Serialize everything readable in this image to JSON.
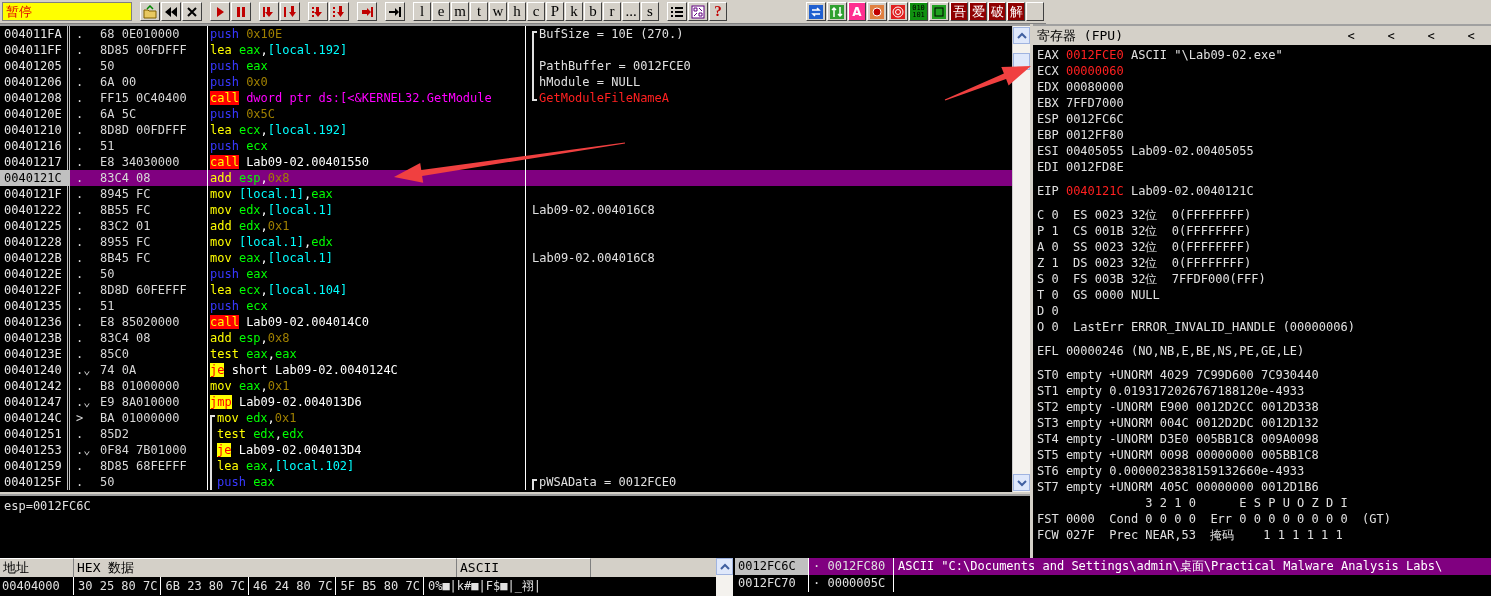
{
  "toolbar": {
    "status": "暂停",
    "letter_buttons": [
      "l",
      "e",
      "m",
      "t",
      "w",
      "h",
      "c",
      "P",
      "k",
      "b",
      "r",
      "...",
      "s"
    ],
    "help_button": "?",
    "right_buttons": [
      {
        "text": "A",
        "kind": "letter"
      },
      {
        "text": "010 101",
        "kind": "binary"
      },
      {
        "text": "吾",
        "kind": "glyph"
      },
      {
        "text": "爱",
        "kind": "glyph"
      },
      {
        "text": "破",
        "kind": "glyph"
      },
      {
        "text": "解",
        "kind": "glyph"
      }
    ]
  },
  "disassembly": {
    "rows": [
      {
        "address": "004011FA",
        "marker": ".",
        "hex": "68 0E010000",
        "code": [
          {
            "text": "push ",
            "kind": "push"
          },
          {
            "text": "0x10E",
            "kind": "imm"
          }
        ],
        "comment": {
          "text": "BufSize = 10E (270.)",
          "kind": "plain"
        },
        "comment_bracket": {
          "kind": "start"
        },
        "selected": false
      },
      {
        "address": "004011FF",
        "marker": ".",
        "hex": "8D85 00FDFFF",
        "code": [
          {
            "text": "lea ",
            "kind": "op"
          },
          {
            "text": "eax",
            "kind": "reg"
          },
          {
            "text": ",",
            "kind": "punct"
          },
          {
            "text": "[local.192]",
            "kind": "mem"
          }
        ],
        "comment_bracket": {
          "kind": "mid"
        },
        "selected": false
      },
      {
        "address": "00401205",
        "marker": ".",
        "hex": "50",
        "code": [
          {
            "text": "push ",
            "kind": "push"
          },
          {
            "text": "eax",
            "kind": "reg"
          }
        ],
        "comment": {
          "text": "PathBuffer = 0012FCE0",
          "kind": "plain"
        },
        "comment_bracket": {
          "kind": "mid"
        },
        "selected": false
      },
      {
        "address": "00401206",
        "marker": ".",
        "hex": "6A 00",
        "code": [
          {
            "text": "push ",
            "kind": "push"
          },
          {
            "text": "0x0",
            "kind": "imm"
          }
        ],
        "comment": {
          "text": "hModule = NULL",
          "kind": "plain"
        },
        "comment_bracket": {
          "kind": "mid"
        },
        "selected": false
      },
      {
        "address": "00401208",
        "marker": ".",
        "hex": "FF15 0C40400",
        "code": [
          {
            "text": "call",
            "kind": "call"
          },
          {
            "text": " dword ptr ds:[<&KERNEL32.GetModule",
            "kind": "api"
          }
        ],
        "comment": {
          "text": "GetModuleFileNameA",
          "kind": "api"
        },
        "comment_bracket": {
          "kind": "end"
        },
        "selected": false
      },
      {
        "address": "0040120E",
        "marker": ".",
        "hex": "6A 5C",
        "code": [
          {
            "text": "push ",
            "kind": "push"
          },
          {
            "text": "0x5C",
            "kind": "imm"
          }
        ],
        "selected": false
      },
      {
        "address": "00401210",
        "marker": ".",
        "hex": "8D8D 00FDFFF",
        "code": [
          {
            "text": "lea ",
            "kind": "op"
          },
          {
            "text": "ecx",
            "kind": "reg"
          },
          {
            "text": ",",
            "kind": "punct"
          },
          {
            "text": "[local.192]",
            "kind": "mem"
          }
        ],
        "selected": false
      },
      {
        "address": "00401216",
        "marker": ".",
        "hex": "51",
        "code": [
          {
            "text": "push ",
            "kind": "push"
          },
          {
            "text": "ecx",
            "kind": "reg"
          }
        ],
        "selected": false
      },
      {
        "address": "00401217",
        "marker": ".",
        "hex": "E8 34030000",
        "code": [
          {
            "text": "call",
            "kind": "call"
          },
          {
            "text": " Lab09-02.00401550",
            "kind": "label"
          }
        ],
        "selected": false
      },
      {
        "address": "0040121C",
        "marker": ".",
        "hex": "83C4 08",
        "code": [
          {
            "text": "add ",
            "kind": "op"
          },
          {
            "text": "esp",
            "kind": "reg"
          },
          {
            "text": ",",
            "kind": "punct"
          },
          {
            "text": "0x8",
            "kind": "imm"
          }
        ],
        "selected": true
      },
      {
        "address": "0040121F",
        "marker": ".",
        "hex": "8945 FC",
        "code": [
          {
            "text": "mov ",
            "kind": "op"
          },
          {
            "text": "[local.1]",
            "kind": "mem"
          },
          {
            "text": ",",
            "kind": "punct"
          },
          {
            "text": "eax",
            "kind": "reg"
          }
        ],
        "selected": false
      },
      {
        "address": "00401222",
        "marker": ".",
        "hex": "8B55 FC",
        "code": [
          {
            "text": "mov ",
            "kind": "op"
          },
          {
            "text": "edx",
            "kind": "reg"
          },
          {
            "text": ",",
            "kind": "punct"
          },
          {
            "text": "[local.1]",
            "kind": "mem"
          }
        ],
        "comment": {
          "text": "Lab09-02.004016C8",
          "kind": "plain"
        },
        "selected": false
      },
      {
        "address": "00401225",
        "marker": ".",
        "hex": "83C2 01",
        "code": [
          {
            "text": "add ",
            "kind": "op"
          },
          {
            "text": "edx",
            "kind": "reg"
          },
          {
            "text": ",",
            "kind": "punct"
          },
          {
            "text": "0x1",
            "kind": "imm"
          }
        ],
        "selected": false
      },
      {
        "address": "00401228",
        "marker": ".",
        "hex": "8955 FC",
        "code": [
          {
            "text": "mov ",
            "kind": "op"
          },
          {
            "text": "[local.1]",
            "kind": "mem"
          },
          {
            "text": ",",
            "kind": "punct"
          },
          {
            "text": "edx",
            "kind": "reg"
          }
        ],
        "selected": false
      },
      {
        "address": "0040122B",
        "marker": ".",
        "hex": "8B45 FC",
        "code": [
          {
            "text": "mov ",
            "kind": "op"
          },
          {
            "text": "eax",
            "kind": "reg"
          },
          {
            "text": ",",
            "kind": "punct"
          },
          {
            "text": "[local.1]",
            "kind": "mem"
          }
        ],
        "comment": {
          "text": "Lab09-02.004016C8",
          "kind": "plain"
        },
        "selected": false
      },
      {
        "address": "0040122E",
        "marker": ".",
        "hex": "50",
        "code": [
          {
            "text": "push ",
            "kind": "push"
          },
          {
            "text": "eax",
            "kind": "reg"
          }
        ],
        "selected": false
      },
      {
        "address": "0040122F",
        "marker": ".",
        "hex": "8D8D 60FEFFF",
        "code": [
          {
            "text": "lea ",
            "kind": "op"
          },
          {
            "text": "ecx",
            "kind": "reg"
          },
          {
            "text": ",",
            "kind": "punct"
          },
          {
            "text": "[local.104]",
            "kind": "mem"
          }
        ],
        "selected": false
      },
      {
        "address": "00401235",
        "marker": ".",
        "hex": "51",
        "code": [
          {
            "text": "push ",
            "kind": "push"
          },
          {
            "text": "ecx",
            "kind": "reg"
          }
        ],
        "selected": false
      },
      {
        "address": "00401236",
        "marker": ".",
        "hex": "E8 85020000",
        "code": [
          {
            "text": "call",
            "kind": "call"
          },
          {
            "text": " Lab09-02.004014C0",
            "kind": "label"
          }
        ],
        "selected": false
      },
      {
        "address": "0040123B",
        "marker": ".",
        "hex": "83C4 08",
        "code": [
          {
            "text": "add ",
            "kind": "op"
          },
          {
            "text": "esp",
            "kind": "reg"
          },
          {
            "text": ",",
            "kind": "punct"
          },
          {
            "text": "0x8",
            "kind": "imm"
          }
        ],
        "selected": false
      },
      {
        "address": "0040123E",
        "marker": ".",
        "hex": "85C0",
        "code": [
          {
            "text": "test ",
            "kind": "op"
          },
          {
            "text": "eax",
            "kind": "reg"
          },
          {
            "text": ",",
            "kind": "punct"
          },
          {
            "text": "eax",
            "kind": "reg"
          }
        ],
        "selected": false
      },
      {
        "address": "00401240",
        "marker": ".⌄",
        "hex": "74 0A",
        "code": [
          {
            "text": "je",
            "kind": "jump"
          },
          {
            "text": " short Lab09-02.0040124C",
            "kind": "label"
          }
        ],
        "selected": false
      },
      {
        "address": "00401242",
        "marker": ".",
        "hex": "B8 01000000",
        "code": [
          {
            "text": "mov ",
            "kind": "op"
          },
          {
            "text": "eax",
            "kind": "reg"
          },
          {
            "text": ",",
            "kind": "punct"
          },
          {
            "text": "0x1",
            "kind": "imm"
          }
        ],
        "selected": false
      },
      {
        "address": "00401247",
        "marker": ".⌄",
        "hex": "E9 8A010000",
        "code": [
          {
            "text": "jmp",
            "kind": "jump"
          },
          {
            "text": " Lab09-02.004013D6",
            "kind": "label"
          }
        ],
        "selected": false
      },
      {
        "address": "0040124C",
        "marker": ">",
        "hex": "BA 01000000",
        "code": [
          {
            "text": "mov ",
            "kind": "op"
          },
          {
            "text": "edx",
            "kind": "reg"
          },
          {
            "text": ",",
            "kind": "punct"
          },
          {
            "text": "0x1",
            "kind": "imm"
          }
        ],
        "code_bracket": {
          "kind": "start"
        },
        "selected": false
      },
      {
        "address": "00401251",
        "marker": ".",
        "hex": "85D2",
        "code": [
          {
            "text": "test ",
            "kind": "op"
          },
          {
            "text": "edx",
            "kind": "reg"
          },
          {
            "text": ",",
            "kind": "punct"
          },
          {
            "text": "edx",
            "kind": "reg"
          }
        ],
        "code_bracket": {
          "kind": "mid"
        },
        "selected": false
      },
      {
        "address": "00401253",
        "marker": ".⌄",
        "hex": "0F84 7B01000",
        "code": [
          {
            "text": "je",
            "kind": "jump"
          },
          {
            "text": " Lab09-02.004013D4",
            "kind": "label"
          }
        ],
        "code_bracket": {
          "kind": "mid"
        },
        "selected": false
      },
      {
        "address": "00401259",
        "marker": ".",
        "hex": "8D85 68FEFFF",
        "code": [
          {
            "text": "lea ",
            "kind": "op"
          },
          {
            "text": "eax",
            "kind": "reg"
          },
          {
            "text": ",",
            "kind": "punct"
          },
          {
            "text": "[local.102]",
            "kind": "mem"
          }
        ],
        "code_bracket": {
          "kind": "mid"
        },
        "selected": false
      },
      {
        "address": "0040125F",
        "marker": ".",
        "hex": "50",
        "code": [
          {
            "text": "push ",
            "kind": "push"
          },
          {
            "text": "eax",
            "kind": "reg"
          }
        ],
        "code_bracket": {
          "kind": "mid"
        },
        "comment": {
          "text": "pWSAData = 0012FCE0",
          "kind": "plain"
        },
        "comment_bracket": {
          "kind": "start"
        },
        "selected": false
      }
    ]
  },
  "info_pane": {
    "text": "esp=0012FC6C"
  },
  "registers": {
    "title": "寄存器 (FPU)",
    "title_buttons": [
      "<",
      "<",
      "<",
      "<"
    ],
    "lines": [
      {
        "kind": "reg",
        "name": "EAX",
        "value": "0012FCE0",
        "changed": true,
        "comment": "ASCII \"\\Lab09-02.exe\""
      },
      {
        "kind": "reg",
        "name": "ECX",
        "value": "00000060",
        "changed": true
      },
      {
        "kind": "reg",
        "name": "EDX",
        "value": "00080000",
        "changed": false
      },
      {
        "kind": "reg",
        "name": "EBX",
        "value": "7FFD7000",
        "changed": false
      },
      {
        "kind": "reg",
        "name": "ESP",
        "value": "0012FC6C",
        "changed": false
      },
      {
        "kind": "reg",
        "name": "EBP",
        "value": "0012FF80",
        "changed": false
      },
      {
        "kind": "reg",
        "name": "ESI",
        "value": "00405055",
        "changed": false,
        "comment": "Lab09-02.00405055"
      },
      {
        "kind": "reg",
        "name": "EDI",
        "value": "0012FD8E",
        "changed": false
      },
      {
        "kind": "gap"
      },
      {
        "kind": "reg",
        "name": "EIP",
        "value": "0040121C",
        "changed": true,
        "comment": "Lab09-02.0040121C"
      },
      {
        "kind": "gap"
      },
      {
        "kind": "text",
        "text": "C 0  ES 0023 32位  0(FFFFFFFF)"
      },
      {
        "kind": "text",
        "text": "P 1  CS 001B 32位  0(FFFFFFFF)"
      },
      {
        "kind": "text",
        "text": "A 0  SS 0023 32位  0(FFFFFFFF)"
      },
      {
        "kind": "text",
        "text": "Z 1  DS 0023 32位  0(FFFFFFFF)"
      },
      {
        "kind": "text",
        "text": "S 0  FS 003B 32位  7FFDF000(FFF)"
      },
      {
        "kind": "text",
        "text": "T 0  GS 0000 NULL"
      },
      {
        "kind": "text",
        "text": "D 0"
      },
      {
        "kind": "text",
        "text": "O 0  LastErr ERROR_INVALID_HANDLE (00000006)"
      },
      {
        "kind": "gap"
      },
      {
        "kind": "text",
        "text": "EFL 00000246 (NO,NB,E,BE,NS,PE,GE,LE)"
      },
      {
        "kind": "gap"
      },
      {
        "kind": "text",
        "text": "ST0 empty +UNORM 4029 7C99D600 7C930440"
      },
      {
        "kind": "text",
        "text": "ST1 empty 0.0193172026767188120e-4933"
      },
      {
        "kind": "text",
        "text": "ST2 empty -UNORM E900 0012D2CC 0012D338"
      },
      {
        "kind": "text",
        "text": "ST3 empty +UNORM 004C 0012D2DC 0012D132"
      },
      {
        "kind": "text",
        "text": "ST4 empty -UNORM D3E0 005BB1C8 009A0098"
      },
      {
        "kind": "text",
        "text": "ST5 empty +UNORM 0098 00000000 005BB1C8"
      },
      {
        "kind": "text",
        "text": "ST6 empty 0.0000023838159132660e-4933"
      },
      {
        "kind": "text",
        "text": "ST7 empty +UNORM 405C 00000000 0012D1B6"
      },
      {
        "kind": "text",
        "text": "               3 2 1 0      E S P U O Z D I"
      },
      {
        "kind": "text",
        "text": "FST 0000  Cond 0 0 0 0  Err 0 0 0 0 0 0 0 0  (GT)"
      },
      {
        "kind": "text",
        "text": "FCW 027F  Prec NEAR,53  掩码    1 1 1 1 1 1"
      }
    ]
  },
  "dump": {
    "columns": [
      "地址",
      "HEX 数据",
      "ASCII"
    ],
    "rows": [
      {
        "address": "00404000",
        "hex": [
          "30 25 80 7C",
          "6B 23 80 7C",
          "46 24 80 7C",
          "5F B5 80 7C"
        ],
        "ascii": "0%■|k#■|F$■|_祤|"
      }
    ]
  },
  "stack": {
    "rows": [
      {
        "address": "0012FC6C",
        "value": "· 0012FC80",
        "comment": "ASCII \"C:\\Documents and Settings\\admin\\桌面\\Practical Malware Analysis Labs\\",
        "selected": true
      },
      {
        "address": "0012FC70",
        "value": "· 0000005C",
        "selected": false
      }
    ]
  }
}
